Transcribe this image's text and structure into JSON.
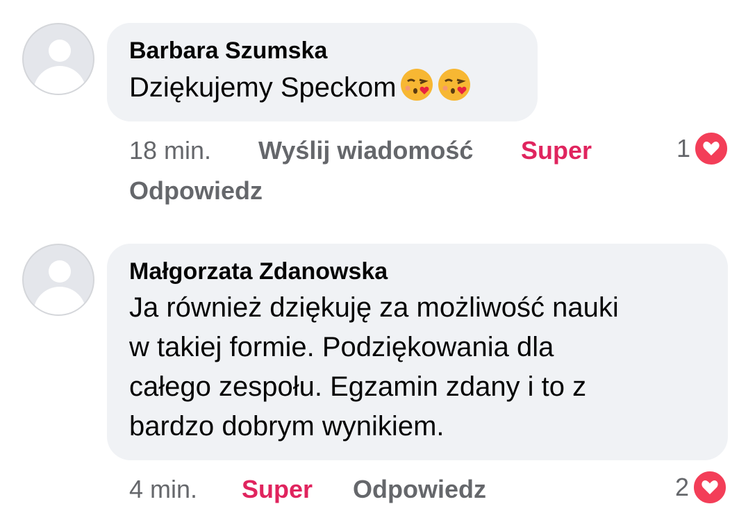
{
  "comments": [
    {
      "author": "Barbara Szumska",
      "text": "Dziękujemy Speckom",
      "emoji": [
        "kissing-heart-emoji",
        "kissing-heart-emoji"
      ],
      "time": "18 min.",
      "send_message": "Wyślij wiadomość",
      "reaction_label": "Super",
      "reply_label": "Odpowiedz",
      "reaction_count": "1",
      "reaction_icon": "heart-icon"
    },
    {
      "author": "Małgorzata Zdanowska",
      "text_lines": [
        "Ja również dziękuję za możliwość nauki",
        "w takiej formie. Podziękowania dla",
        "całego zespołu. Egzamin zdany i to z",
        "bardzo dobrym wynikiem."
      ],
      "time": "4 min.",
      "reaction_label": "Super",
      "reply_label": "Odpowiedz",
      "reaction_count": "2",
      "reaction_icon": "heart-icon"
    }
  ],
  "colors": {
    "bubble": "#f0f2f5",
    "meta": "#65676b",
    "super": "#e0245e",
    "heart": "#f33e58"
  }
}
